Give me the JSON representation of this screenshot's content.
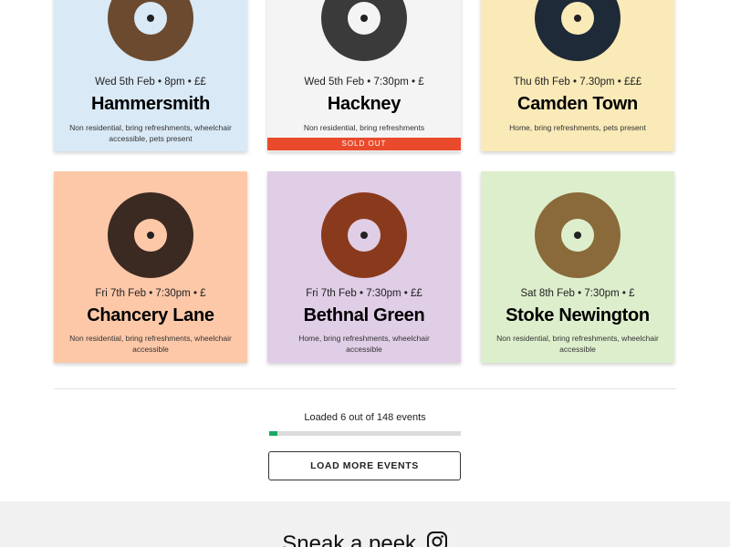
{
  "events": [
    {
      "meta": "Wed 5th Feb • 8pm • ££",
      "title": "Hammersmith",
      "desc": "Non residential, bring refreshments, wheelchair accessible, pets present",
      "bg": "#d9e9f6",
      "vinyl_color": "#6b4a2f",
      "status": ""
    },
    {
      "meta": "Wed 5th Feb • 7:30pm • £",
      "title": "Hackney",
      "desc": "Non residential, bring refreshments",
      "bg": "#f4f4f4",
      "vinyl_color": "#3a3a3a",
      "status": "SOLD OUT"
    },
    {
      "meta": "Thu 6th Feb • 7.30pm • £££",
      "title": "Camden Town",
      "desc": "Home, bring refreshments, pets present",
      "bg": "#f9eab8",
      "vinyl_color": "#1f2a38",
      "status": ""
    },
    {
      "meta": "Fri 7th Feb • 7:30pm • £",
      "title": "Chancery Lane",
      "desc": "Non residential, bring refreshments, wheelchair accessible",
      "bg": "#fdc8a8",
      "vinyl_color": "#3b2a22",
      "status": ""
    },
    {
      "meta": "Fri 7th Feb • 7:30pm • ££",
      "title": "Bethnal Green",
      "desc": "Home, bring refreshments, wheelchair accessible",
      "bg": "#e0cde6",
      "vinyl_color": "#8a3a1c",
      "status": ""
    },
    {
      "meta": "Sat 8th Feb • 7:30pm • £",
      "title": "Stoke Newington",
      "desc": "Non residential, bring refreshments, wheelchair accessible",
      "bg": "#ddeecc",
      "vinyl_color": "#8a6a3a",
      "status": ""
    }
  ],
  "colors": {
    "sold_out": "#ea4a2c",
    "progress": "#1aa864"
  },
  "pagination": {
    "loaded_text": "Loaded 6 out of 148 events",
    "loaded": 6,
    "total": 148,
    "button_label": "LOAD MORE EVENTS"
  },
  "footer": {
    "peek_text": "Sneak a peek",
    "icon": "instagram-icon"
  }
}
